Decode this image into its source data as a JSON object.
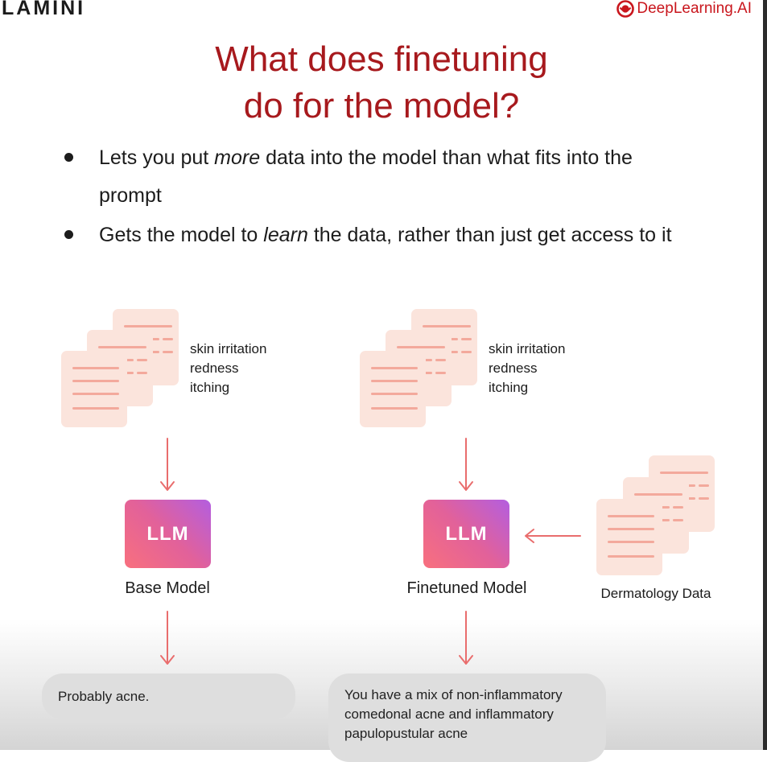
{
  "header": {
    "logo": "LAMINI",
    "brand": "DeepLearning.AI"
  },
  "title": {
    "line1": "What does finetuning",
    "line2": "do for the model?"
  },
  "bullets": [
    {
      "pre": "Lets you put ",
      "em": "more",
      "post": " data into the model than what fits into the prompt"
    },
    {
      "pre": "Gets the model to ",
      "em": "learn",
      "post": " the data, rather than just get access to it"
    }
  ],
  "diagram": {
    "symptoms": [
      "skin irritation",
      "redness",
      "itching"
    ],
    "llm_label": "LLM",
    "base_model": "Base Model",
    "finetuned_model": "Finetuned Model",
    "dermatology_label": "Dermatology Data",
    "base_output": "Probably acne.",
    "finetuned_output": "You have a mix of non-inflammatory comedonal acne and inflammatory papulopustular acne"
  },
  "colors": {
    "title": "#a7191d",
    "brand": "#c9161d",
    "arrow": "#e96d6d",
    "doc_fill": "#fbe4dc",
    "doc_line": "#f3a99c"
  }
}
